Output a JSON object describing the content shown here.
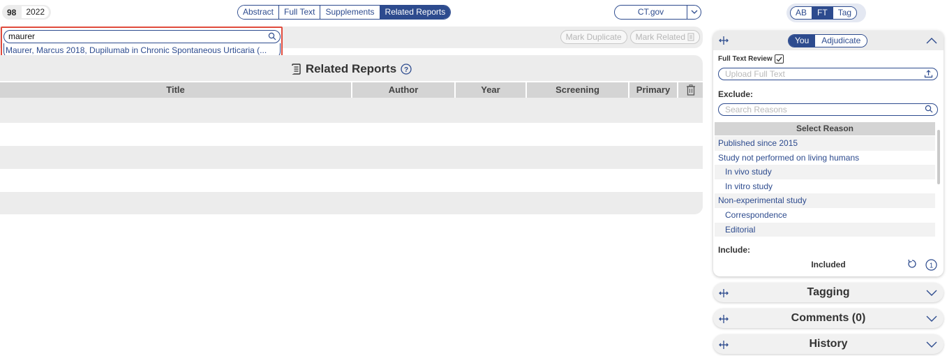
{
  "record": {
    "id": "98",
    "year": "2022"
  },
  "tabs": [
    "Abstract",
    "Full Text",
    "Supplements",
    "Related Reports"
  ],
  "active_tab": "Related Reports",
  "ctgov_label": "CT.gov",
  "modes": [
    "AB",
    "FT",
    "Tag"
  ],
  "active_mode": "FT",
  "search": {
    "value": "maurer",
    "result": "Maurer, Marcus 2018, Dupilumab in Chronic Spontaneous Urticaria (..."
  },
  "mark_buttons": {
    "duplicate": "Mark Duplicate",
    "related": "Mark Related"
  },
  "related_reports": {
    "title": "Related Reports",
    "columns": [
      "Title",
      "Author",
      "Year",
      "Screening",
      "Primary"
    ],
    "rows": 5
  },
  "review_panel": {
    "toggle": [
      "You",
      "Adjudicate"
    ],
    "active_toggle": "You",
    "full_text_review_label": "Full Text Review",
    "upload_placeholder": "Upload Full Text",
    "exclude_label": "Exclude:",
    "search_reasons_placeholder": "Search Reasons",
    "select_reason_header": "Select Reason",
    "reasons": [
      {
        "label": "Published since 2015",
        "sub": false
      },
      {
        "label": "Study not performed on living humans",
        "sub": false
      },
      {
        "label": "In vivo study",
        "sub": true
      },
      {
        "label": "In vitro study",
        "sub": true
      },
      {
        "label": "Non-experimental study",
        "sub": false
      },
      {
        "label": "Correspondence",
        "sub": true
      },
      {
        "label": "Editorial",
        "sub": true
      }
    ],
    "include_label": "Include:",
    "include_value": "Included"
  },
  "accordions": [
    "Tagging",
    "Comments (0)",
    "History"
  ],
  "colors": {
    "primary": "#2d4b8e",
    "highlight": "#e04a3c",
    "panel": "#ececec"
  }
}
